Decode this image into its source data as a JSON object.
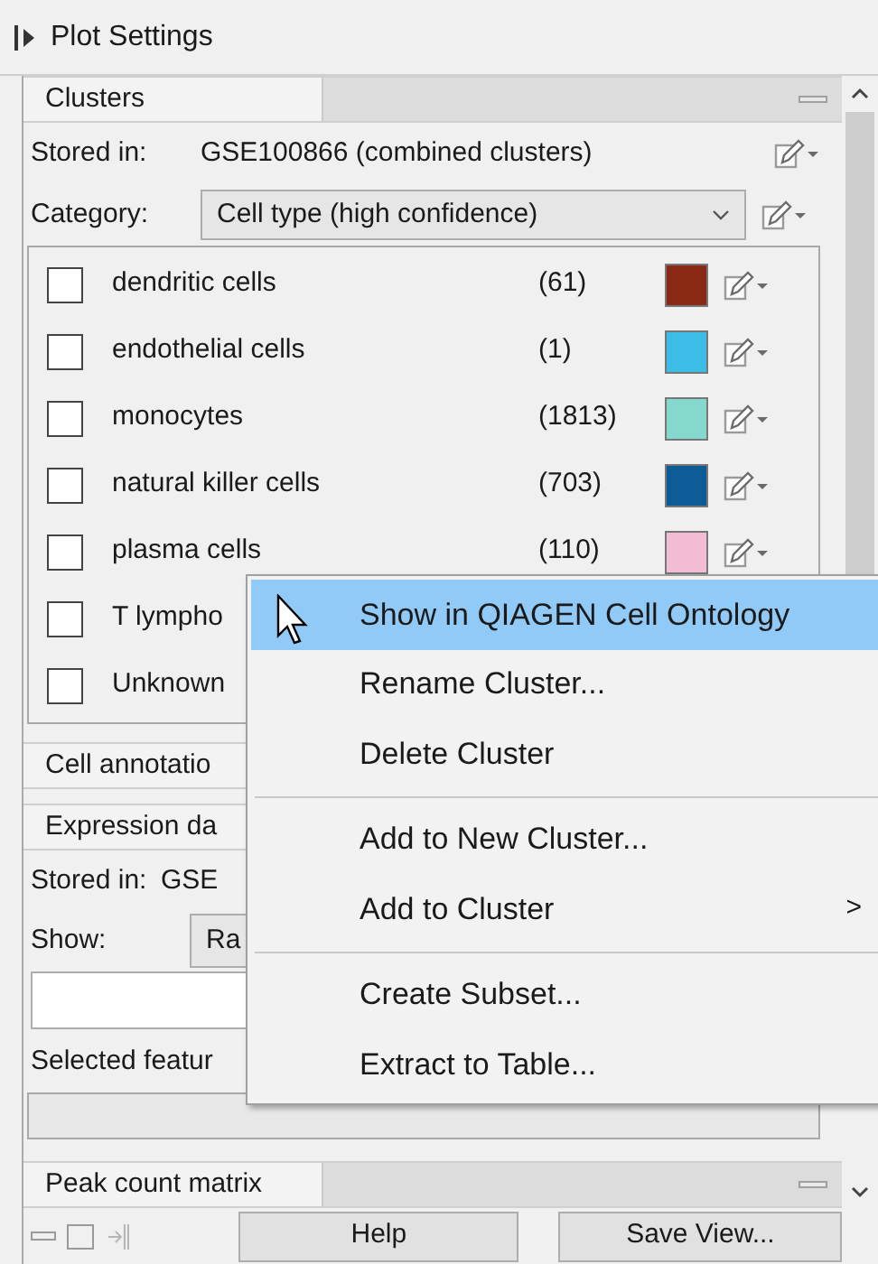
{
  "header": {
    "title": "Plot Settings"
  },
  "clusters": {
    "tab": "Clusters",
    "stored_label": "Stored in:",
    "stored_value": "GSE100866 (combined clusters)",
    "category_label": "Category:",
    "category_value": "Cell type (high confidence)",
    "items": [
      {
        "name": "dendritic cells",
        "count": "(61)",
        "color": "#8b2a14",
        "checked": false
      },
      {
        "name": "endothelial cells",
        "count": "(1)",
        "color": "#3bbde6",
        "checked": false
      },
      {
        "name": "monocytes",
        "count": "(1813)",
        "color": "#85d8cc",
        "checked": false
      },
      {
        "name": "natural killer cells",
        "count": "(703)",
        "color": "#0d5c96",
        "checked": false
      },
      {
        "name": "plasma cells",
        "count": "(110)",
        "color": "#f2bcd4",
        "checked": false
      },
      {
        "name": "T lympho",
        "checked": false
      },
      {
        "name": "Unknown",
        "checked": false
      }
    ]
  },
  "cell_annotation": {
    "tab": "Cell annotatio"
  },
  "expression": {
    "tab": "Expression da",
    "stored_label": "Stored in:",
    "stored_value": "GSE",
    "show_label": "Show:",
    "show_value": "Ra",
    "selected_label": "Selected featur"
  },
  "peak": {
    "tab": "Peak count matrix"
  },
  "buttons": [
    "Help",
    "Save View..."
  ],
  "menu": [
    {
      "kind": "item",
      "label": "Show in QIAGEN Cell Ontology",
      "selected": true
    },
    {
      "kind": "item",
      "label": "Rename Cluster...",
      "selected": false
    },
    {
      "kind": "item",
      "label": "Delete Cluster",
      "selected": false
    },
    {
      "kind": "separator"
    },
    {
      "kind": "item",
      "label": "Add to New Cluster...",
      "selected": false
    },
    {
      "kind": "submenu",
      "label": "Add to Cluster",
      "arrow": ">",
      "selected": false
    },
    {
      "kind": "separator"
    },
    {
      "kind": "item",
      "label": "Create Subset...",
      "selected": false
    },
    {
      "kind": "item",
      "label": "Extract to Table...",
      "selected": false
    }
  ]
}
